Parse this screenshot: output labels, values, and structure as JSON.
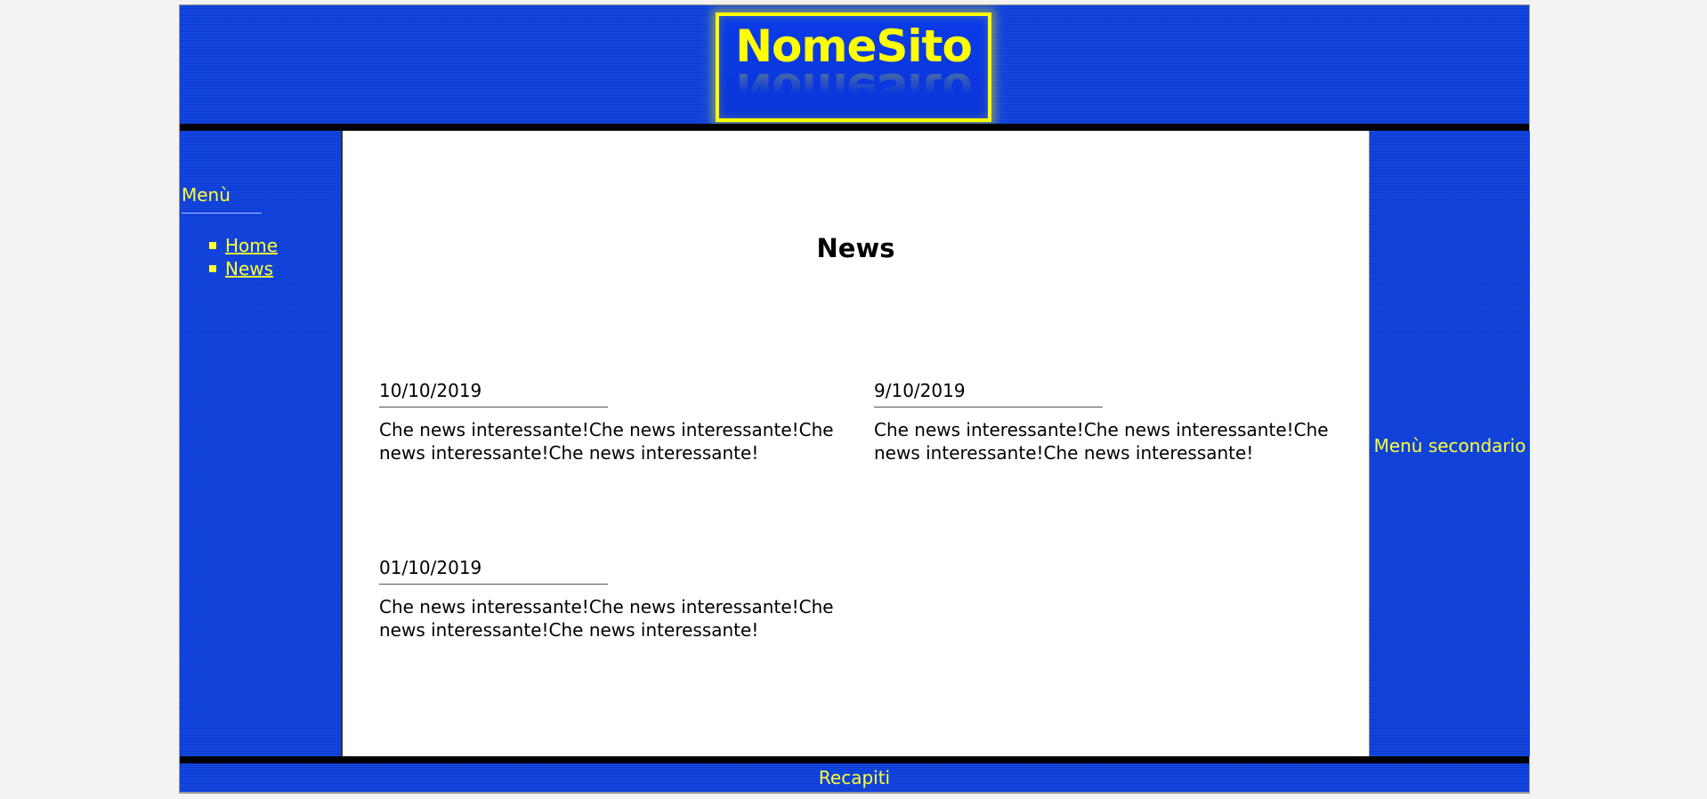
{
  "header": {
    "logo_text": "NomeSito"
  },
  "left_menu": {
    "title": "Menù",
    "items": [
      {
        "label": "Home"
      },
      {
        "label": "News"
      }
    ]
  },
  "main": {
    "title": "News",
    "news": [
      {
        "date": "10/10/2019",
        "text": "Che news interessante!Che news interessante!Che news interessante!Che news interessante!"
      },
      {
        "date": "9/10/2019",
        "text": "Che news interessante!Che news interessante!Che news interessante!Che news interessante!"
      },
      {
        "date": "01/10/2019",
        "text": "Che news interessante!Che news interessante!Che news interessante!Che news interessante!"
      }
    ]
  },
  "right_menu": {
    "label": "Menù secondario"
  },
  "footer": {
    "label": "Recapiti"
  },
  "colors": {
    "background_blue": "#0a3fe0",
    "accent_yellow": "#ffff33",
    "page_background": "#f3f3f3"
  }
}
